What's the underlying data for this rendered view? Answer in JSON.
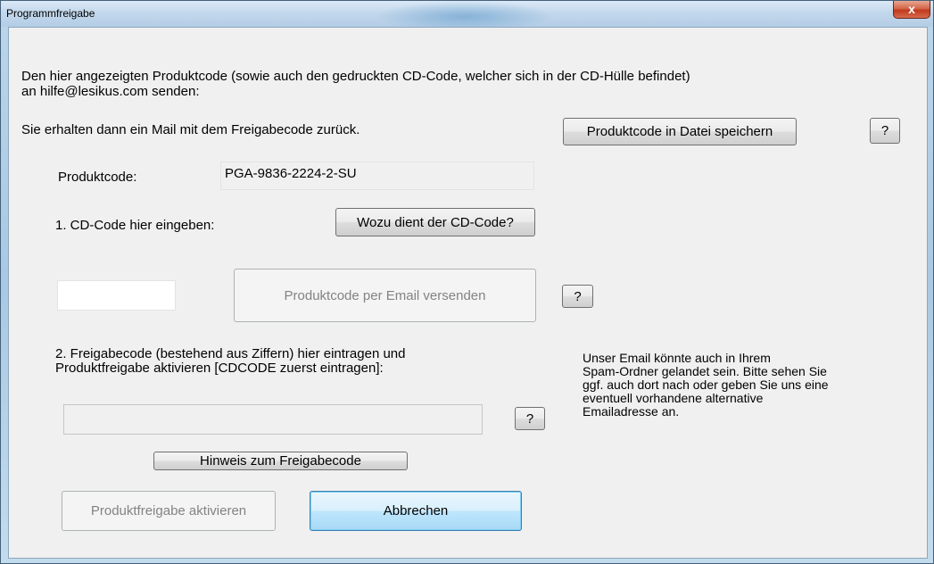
{
  "window": {
    "title": "Programmfreigabe",
    "close_symbol": "x"
  },
  "intro": {
    "line1": "Den hier angezeigten Produktcode (sowie auch den gedruckten CD-Code, welcher sich in der CD-Hülle befindet)",
    "line2": "an  hilfe@lesikus.com  senden:",
    "line3": "Sie erhalten dann ein Mail mit dem Freigabecode zurück."
  },
  "buttons": {
    "save_code": "Produktcode in Datei speichern",
    "help": "?",
    "cd_code_info": "Wozu dient der CD-Code?",
    "send_email": "Produktcode per Email versenden",
    "release_hint": "Hinweis zum Freigabecode",
    "activate": "Produktfreigabe aktivieren",
    "cancel": "Abbrechen"
  },
  "product": {
    "label": "Produktcode:",
    "value": "PGA-9836-2224-2-SU"
  },
  "cd_code": {
    "label": "1. CD-Code hier eingeben:",
    "value": ""
  },
  "release": {
    "label_line1": "2. Freigabecode (bestehend aus Ziffern) hier eintragen und",
    "label_line2": "Produktfreigabe aktivieren [CDCODE zuerst eintragen]:",
    "value": ""
  },
  "spam_note": {
    "line1": "Unser Email könnte auch in Ihrem",
    "line2": "Spam-Ordner gelandet sein. Bitte sehen Sie",
    "line3": "ggf. auch dort nach oder geben Sie uns eine",
    "line4": "eventuell vorhandene alternative",
    "line5": "Emailadresse an."
  }
}
